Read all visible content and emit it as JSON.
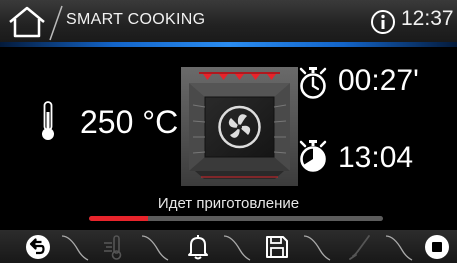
{
  "header": {
    "title": "SMART COOKING",
    "time": "12:37"
  },
  "main": {
    "temperature": "250 °C",
    "cook_timer": "00:27'",
    "end_time": "13:04",
    "status": "Идет приготовление",
    "progress_percent": 20
  },
  "icons": {
    "home": "home-icon",
    "info": "info-icon",
    "thermometer": "thermometer-icon",
    "oven_fan": "oven-fan-icon",
    "timer": "stopwatch-icon",
    "end_time": "stopwatch-filled-icon",
    "back": "back-arrow-icon",
    "temperature": "thermometer-lines-icon",
    "alarm": "bell-icon",
    "save": "floppy-disk-icon",
    "probe": "meat-probe-icon",
    "stop": "stop-icon"
  },
  "colors": {
    "accent": "#2a8cf0",
    "progress": "#e8242b",
    "heater": "#e8242b"
  }
}
